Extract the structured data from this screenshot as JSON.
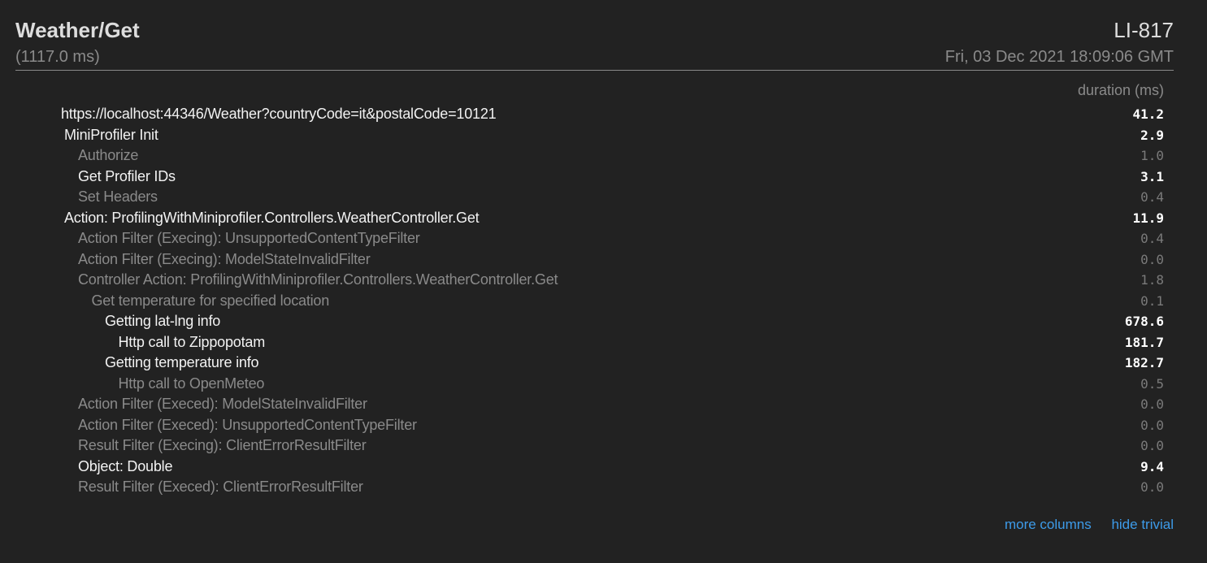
{
  "header": {
    "title": "Weather/Get",
    "total_duration": "(1117.0 ms)",
    "machine_name": "LI-817",
    "started": "Fri, 03 Dec 2021 18:09:06 GMT"
  },
  "table": {
    "duration_header": "duration (ms)",
    "rows": [
      {
        "name": "https://localhost:44346/Weather?countryCode=it&postalCode=10121",
        "duration": "41.2",
        "depth": 0,
        "trivial": false
      },
      {
        "name": "MiniProfiler Init",
        "duration": "2.9",
        "depth": 1,
        "trivial": false
      },
      {
        "name": "Authorize",
        "duration": "1.0",
        "depth": 2,
        "trivial": true
      },
      {
        "name": "Get Profiler IDs",
        "duration": "3.1",
        "depth": 2,
        "trivial": false
      },
      {
        "name": "Set Headers",
        "duration": "0.4",
        "depth": 2,
        "trivial": true
      },
      {
        "name": "Action: ProfilingWithMiniprofiler.Controllers.WeatherController.Get",
        "duration": "11.9",
        "depth": 1,
        "trivial": false
      },
      {
        "name": "Action Filter (Execing): UnsupportedContentTypeFilter",
        "duration": "0.4",
        "depth": 2,
        "trivial": true
      },
      {
        "name": "Action Filter (Execing): ModelStateInvalidFilter",
        "duration": "0.0",
        "depth": 2,
        "trivial": true
      },
      {
        "name": "Controller Action: ProfilingWithMiniprofiler.Controllers.WeatherController.Get",
        "duration": "1.8",
        "depth": 2,
        "trivial": true
      },
      {
        "name": "Get temperature for specified location",
        "duration": "0.1",
        "depth": 3,
        "trivial": true
      },
      {
        "name": "Getting lat-lng info",
        "duration": "678.6",
        "depth": 4,
        "trivial": false
      },
      {
        "name": "Http call to Zippopotam",
        "duration": "181.7",
        "depth": 5,
        "trivial": false
      },
      {
        "name": "Getting temperature info",
        "duration": "182.7",
        "depth": 4,
        "trivial": false
      },
      {
        "name": "Http call to OpenMeteo",
        "duration": "0.5",
        "depth": 5,
        "trivial": true
      },
      {
        "name": "Action Filter (Execed): ModelStateInvalidFilter",
        "duration": "0.0",
        "depth": 2,
        "trivial": true
      },
      {
        "name": "Action Filter (Execed): UnsupportedContentTypeFilter",
        "duration": "0.0",
        "depth": 2,
        "trivial": true
      },
      {
        "name": "Result Filter (Execing): ClientErrorResultFilter",
        "duration": "0.0",
        "depth": 2,
        "trivial": true
      },
      {
        "name": "Object: Double",
        "duration": "9.4",
        "depth": 2,
        "trivial": false
      },
      {
        "name": "Result Filter (Execed): ClientErrorResultFilter",
        "duration": "0.0",
        "depth": 2,
        "trivial": true
      }
    ]
  },
  "footer": {
    "more_columns": "more columns",
    "hide_trivial": "hide trivial"
  }
}
